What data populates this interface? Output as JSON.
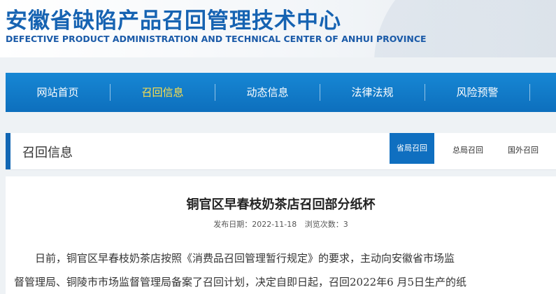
{
  "header": {
    "title_cn": "安徽省缺陷产品召回管理技术中心",
    "title_en": "DEFECTIVE PRODUCT ADMINISTRATION AND TECHNICAL CENTER OF ANHUI PROVINCE"
  },
  "nav": {
    "items": [
      {
        "label": "网站首页"
      },
      {
        "label": "召回信息"
      },
      {
        "label": "动态信息"
      },
      {
        "label": "法律法规"
      },
      {
        "label": "风险预警"
      }
    ],
    "active": "召回信息"
  },
  "section": {
    "title": "召回信息",
    "tabs": [
      {
        "label": "省局召回"
      },
      {
        "label": "总局召回"
      },
      {
        "label": "国外召回"
      }
    ],
    "active_tab": "省局召回"
  },
  "article": {
    "title": "铜官区早春枝奶茶店召回部分纸杯",
    "publish_label": "发布日期：",
    "publish_date": "2022-11-18",
    "views_label": "浏览次数：",
    "views": "3",
    "body_line1": "日前，铜官区早春枝奶茶店按照《消费品召回管理暂行规定》的要求，主动向安徽省市场监",
    "body_line2": "督管理局、铜陵市市场监督管理局备案了召回计划，决定自即日起，召回2022年6  月5日生产的纸"
  },
  "colors": {
    "brand_blue": "#1663b2",
    "nav_blue": "#0d6fbd",
    "active_yellow": "#ffe04a"
  }
}
